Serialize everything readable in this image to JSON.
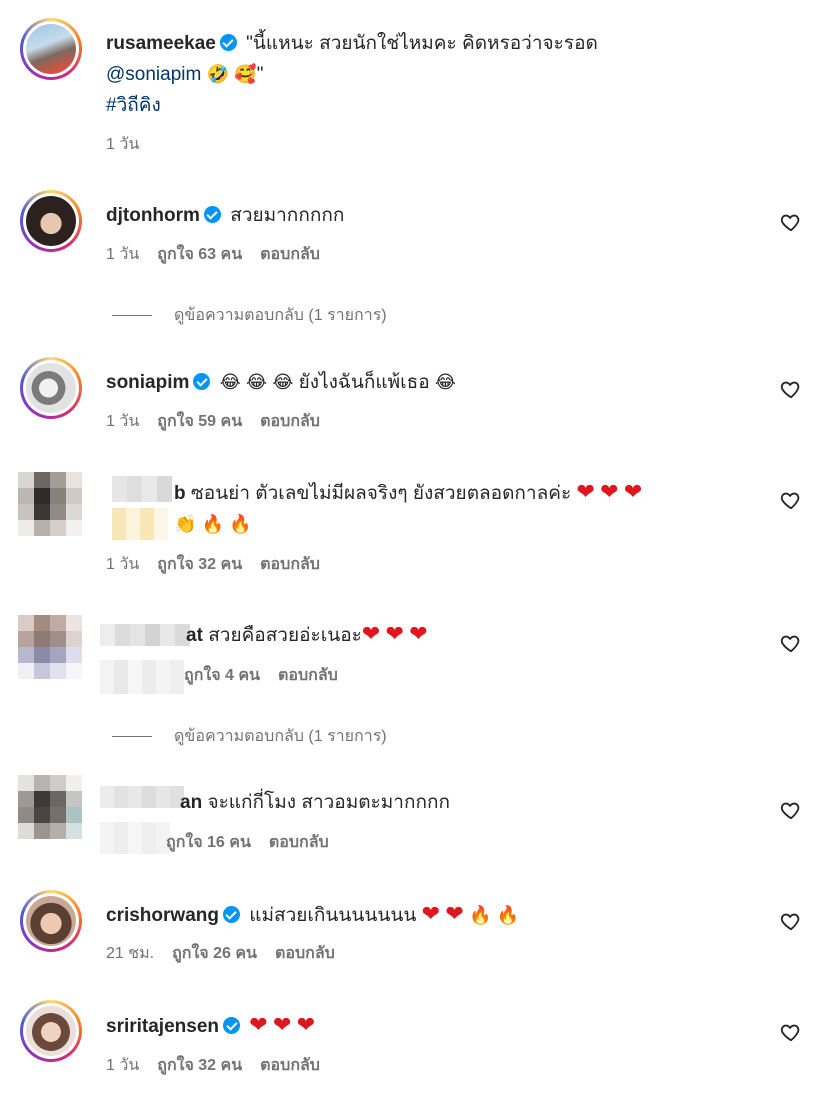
{
  "caption": {
    "username": "rusameekae",
    "text_part1": "\"นี้แหนะ สวยนักใช่ไหมคะ คิดหรอว่าจะรอด",
    "mention": "@soniapim",
    "emoji1": "🤣",
    "emoji2": "🥰",
    "quote_close": "\"",
    "hashtag": "#วิถีคิง",
    "time": "1 วัน"
  },
  "comments": [
    {
      "username": "djtonhorm",
      "text": "สวยมากกกกก",
      "time": "1 วัน",
      "likes": "ถูกใจ 63 คน",
      "reply_label": "ตอบกลับ",
      "view_replies": "ดูข้อความตอบกลับ (1 รายการ)"
    },
    {
      "username": "soniapim",
      "emoji_laugh": "😂",
      "text": "ยังไงฉันก็แพ้เธอ",
      "time": "1 วัน",
      "likes": "ถูกใจ 59 คน",
      "reply_label": "ตอบกลับ"
    },
    {
      "username_visible_end": "b",
      "text": "ซอนย่า ตัวเลขไม่มีผลจริงๆ ยังสวยตลอดกาลค่ะ",
      "heart": "❤",
      "clap": "👏",
      "fire": "🔥",
      "time": "1 วัน",
      "likes": "ถูกใจ 32 คน",
      "reply_label": "ตอบกลับ"
    },
    {
      "username_visible_end": "at",
      "text": "สวยคือสวยอ่ะเนอะ",
      "heart": "❤",
      "likes_partial": "ถูกใจ 4 คน",
      "reply_label": "ตอบกลับ",
      "view_replies": "ดูข้อความตอบกลับ (1 รายการ)"
    },
    {
      "username_visible_end": "an",
      "text": "จะแก่กี่โมง สาวอมตะมากกกก",
      "likes_partial": "ถูกใจ 16 คน",
      "reply_label": "ตอบกลับ"
    },
    {
      "username": "crishorwang",
      "text": "แม่สวยเกินนนนนนน",
      "heart": "❤",
      "fire": "🔥",
      "time": "21 ชม.",
      "likes": "ถูกใจ 26 คน",
      "reply_label": "ตอบกลับ"
    },
    {
      "username": "sriritajensen",
      "heart": "❤",
      "time": "1 วัน",
      "likes": "ถูกใจ 32 คน",
      "reply_label": "ตอบกลับ"
    }
  ],
  "icons": {
    "like": "heart-outline-icon",
    "verified": "verified-badge-icon"
  },
  "colors": {
    "verified": "#0095f6",
    "meta": "#737373",
    "link": "#00376b",
    "heart": "#e0161e"
  }
}
